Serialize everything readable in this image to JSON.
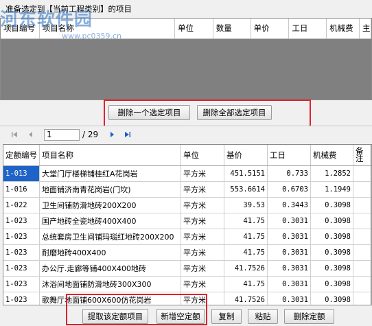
{
  "header": {
    "title": "准备选定到【当前工程类别】的项目",
    "watermark_text": "河东软件园",
    "watermark_url": "www.pc0359.cn"
  },
  "top_table": {
    "columns": [
      "项目编号",
      "项目名称",
      "单位",
      "数量",
      "单价",
      "工日",
      "机械费",
      "主"
    ]
  },
  "top_buttons": {
    "remove_one": "删除一个选定项目",
    "remove_all": "删除全部选定项目"
  },
  "pager": {
    "current_page": "1",
    "total": "/ 29"
  },
  "main_table": {
    "columns": [
      "定额编号",
      "项目名称",
      "单位",
      "基价",
      "工日",
      "机械费",
      "备注"
    ],
    "rows": [
      {
        "code": "1-013",
        "name": "大堂门厅楼梯铺桂红A花岗岩",
        "unit": "平方米",
        "price": "451.5151",
        "work": "0.733",
        "mach": "1.2852"
      },
      {
        "code": "1-016",
        "name": "地面铺济南青花岗岩(门坎)",
        "unit": "平方米",
        "price": "553.6614",
        "work": "0.6703",
        "mach": "1.1949"
      },
      {
        "code": "1-022",
        "name": "卫生间铺防滑地砖200X200",
        "unit": "平方米",
        "price": "39.53",
        "work": "0.3443",
        "mach": "0.3098"
      },
      {
        "code": "1-023",
        "name": "国产地砖全瓷地砖400X400",
        "unit": "平方米",
        "price": "41.75",
        "work": "0.3031",
        "mach": "0.3098"
      },
      {
        "code": "1-023",
        "name": "总统套房卫生间铺玛瑙红地砖200X200",
        "unit": "平方米",
        "price": "41.75",
        "work": "0.3031",
        "mach": "0.3098"
      },
      {
        "code": "1-023",
        "name": "耐磨地砖400X400",
        "unit": "平方米",
        "price": "41.75",
        "work": "0.3031",
        "mach": "0.3098"
      },
      {
        "code": "1-023",
        "name": "办公厅.走廊等铺400X400地砖",
        "unit": "平方米",
        "price": "41.7526",
        "work": "0.3031",
        "mach": "0.3098"
      },
      {
        "code": "1-023",
        "name": "沐浴间地面铺防滑地砖300X300",
        "unit": "平方米",
        "price": "41.75",
        "work": "0.3031",
        "mach": "0.3098"
      },
      {
        "code": "1-023",
        "name": "歌舞厅地面铺600X600仿花岗岩",
        "unit": "平方米",
        "price": "41.7526",
        "work": "0.3031",
        "mach": "0.3098"
      }
    ]
  },
  "bottom_buttons": {
    "fetch": "提取该定额项目",
    "add_empty": "新增空定额",
    "copy": "复制",
    "paste": "粘贴",
    "delete": "删除定额"
  }
}
